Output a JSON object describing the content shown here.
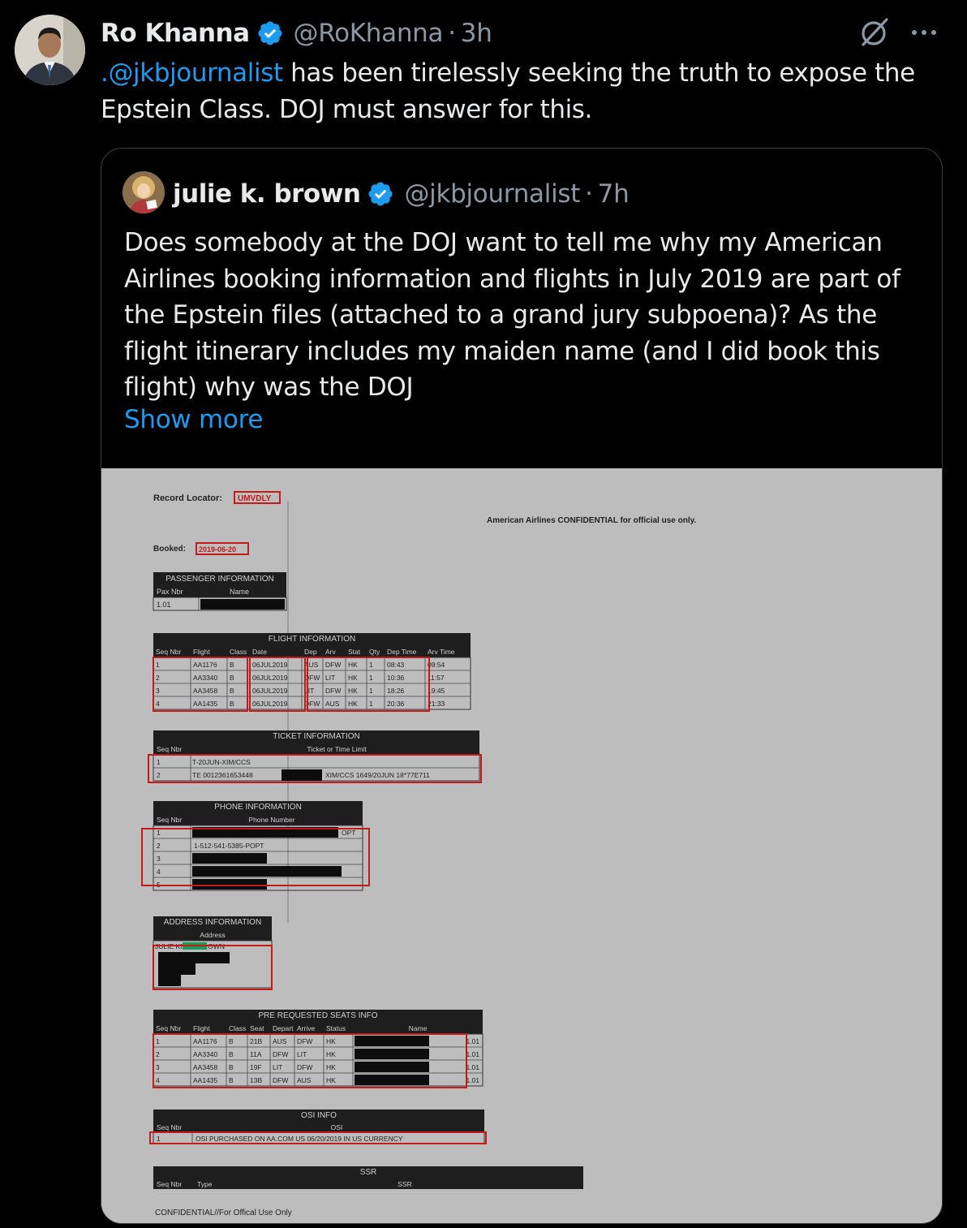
{
  "tweet": {
    "author_name": "Ro Khanna",
    "author_handle": "@RoKhanna",
    "separator": "·",
    "time": "3h",
    "mention": ".@jkbjournalist",
    "text_after_mention": " has been tirelessly seeking the truth to expose the Epstein Class. DOJ must answer for this.",
    "icons": {
      "verified": "verified-badge-icon",
      "grok": "grok-icon",
      "more": "more-options-icon"
    },
    "colors": {
      "background": "#000000",
      "text": "#e7e9ea",
      "secondary": "#8b98a5",
      "accent": "#1d9bf0"
    }
  },
  "quoted_tweet": {
    "author_name": "julie k. brown",
    "author_handle": "@jkbjournalist",
    "separator": "·",
    "time": "7h",
    "text": "Does somebody at the DOJ want to tell me why my American Airlines booking information and flights in July 2019 are part of the Epstein files (attached to a grand jury subpoena)? As the flight itinerary includes my maiden name (and I did book this flight) why was the DOJ",
    "show_more": "Show more"
  },
  "document": {
    "record_locator_label": "Record Locator:",
    "record_locator_value": "UMVDLY",
    "confidential_header": "American Airlines CONFIDENTIAL for official use only.",
    "booked_label": "Booked:",
    "booked_value": "2019-06-20",
    "passenger": {
      "title": "PASSENGER INFORMATION",
      "headers": [
        "Pax Nbr",
        "Name"
      ],
      "rows": [
        [
          "1.01",
          ""
        ]
      ]
    },
    "flight": {
      "title": "FLIGHT INFORMATION",
      "headers": [
        "Seq Nbr",
        "Flight",
        "Class",
        "Date",
        "Dep",
        "Arv",
        "Stat",
        "Qty",
        "Dep Time",
        "Arv Time"
      ],
      "rows": [
        [
          "1",
          "AA1176",
          "B",
          "06JUL2019",
          "AUS",
          "DFW",
          "HK",
          "1",
          "08:43",
          "09:54"
        ],
        [
          "2",
          "AA3340",
          "B",
          "06JUL2019",
          "DFW",
          "LIT",
          "HK",
          "1",
          "10:36",
          "11:57"
        ],
        [
          "3",
          "AA3458",
          "B",
          "06JUL2019",
          "LIT",
          "DFW",
          "HK",
          "1",
          "18:26",
          "19:45"
        ],
        [
          "4",
          "AA1435",
          "B",
          "06JUL2019",
          "DFW",
          "AUS",
          "HK",
          "1",
          "20:36",
          "21:33"
        ]
      ]
    },
    "ticket": {
      "title": "TICKET INFORMATION",
      "headers": [
        "Seq Nbr",
        "Ticket or Time Limit"
      ],
      "rows": [
        [
          "1",
          "T-20JUN-XIM/CCS",
          ""
        ],
        [
          "2",
          "TE 0012361653448",
          "XIM/CCS 1649/20JUN 18*77E711"
        ]
      ]
    },
    "phone": {
      "title": "PHONE INFORMATION",
      "headers": [
        "Seq Nbr",
        "Phone Number"
      ],
      "rows": [
        [
          "1",
          "OPT"
        ],
        [
          "2",
          "1-512-541-5385-POPT"
        ],
        [
          "3",
          ""
        ],
        [
          "4",
          ""
        ],
        [
          "5",
          ""
        ]
      ]
    },
    "address": {
      "title": "ADDRESS INFORMATION",
      "header": "Address",
      "value": "JULIE KNIPE BROWN"
    },
    "seats": {
      "title": "PRE REQUESTED SEATS INFO",
      "headers": [
        "Seq Nbr",
        "Flight",
        "Class",
        "Seat",
        "Depart",
        "Arrive",
        "Status",
        "Name"
      ],
      "rows": [
        [
          "1",
          "AA1176",
          "B",
          "21B",
          "AUS",
          "DFW",
          "HK",
          "1.01"
        ],
        [
          "2",
          "AA3340",
          "B",
          "11A",
          "DFW",
          "LIT",
          "HK",
          "1.01"
        ],
        [
          "3",
          "AA3458",
          "B",
          "19F",
          "LIT",
          "DFW",
          "HK",
          "1.01"
        ],
        [
          "4",
          "AA1435",
          "B",
          "13B",
          "DFW",
          "AUS",
          "HK",
          "1.01"
        ]
      ]
    },
    "osi": {
      "title": "OSI INFO",
      "headers": [
        "Seq Nbr",
        "OSI"
      ],
      "rows": [
        [
          "1",
          "OSI PURCHASED ON AA.COM US 06/20/2019 IN US CURRENCY"
        ]
      ]
    },
    "ssr": {
      "title": "SSR",
      "headers": [
        "Seq Nbr",
        "Type",
        "SSR"
      ]
    },
    "footer": "CONFIDENTIAL//For Offical Use Only"
  }
}
